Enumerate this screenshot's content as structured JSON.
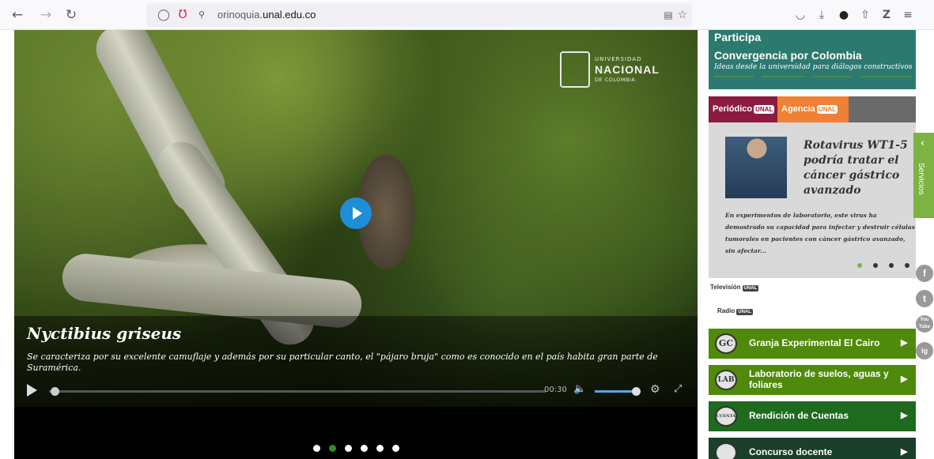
{
  "browser": {
    "back_icon": "back-arrow-icon",
    "forward_icon": "forward-arrow-icon",
    "reload_icon": "reload-icon",
    "url_sub": "orinoquia.",
    "url_main": "unal.edu.co",
    "icons": [
      "shield-icon",
      "permissions-icon",
      "reader-mode-icon",
      "bookmark-star-icon",
      "pocket-icon",
      "download-icon",
      "extension-icon",
      "share-icon",
      "zotero-icon",
      "menu-icon"
    ]
  },
  "hero": {
    "logo": {
      "line1": "UNIVERSIDAD",
      "line2": "NACIONAL",
      "line3": "DE COLOMBIA"
    },
    "title": "Nyctibius griseus",
    "description": "Se caracteriza por su excelente camuflaje y además por su particular canto, el \"pájaro bruja\" como es conocido en el país habita gran parte de Suramérica.",
    "time": "00:30",
    "progress": 0.01,
    "volume": 0.9,
    "slides_total": 6,
    "slides_active": 1
  },
  "sidebar": {
    "participa": {
      "heading": "Participa",
      "title": "Convergencia por Colombia",
      "subtitle": "Ideas desde la universidad para diálogos constructivos"
    },
    "news": {
      "tab1": "Periódico",
      "tab2": "Agencia",
      "badge": "UNAL",
      "title": "Rotavirus WT1-5 podría tratar el cáncer gástrico avanzado",
      "text": "En experimentos de laboratorio, este virus ha demostrado su capacidad para infectar y destruir células tumorales en pacientes con cáncer gástrico avanzado, sin afectar...",
      "dots": 4,
      "active": 0
    },
    "media": {
      "tv": "Televisión",
      "radio": "Radio",
      "badge": "UNAL"
    },
    "links": [
      {
        "icon_text": "GC",
        "label": "Granja Experimental El Cairo",
        "bg": "#4f8a0a"
      },
      {
        "icon_text": "LAB",
        "label": "Laboratorio de suelos, aguas y foliares",
        "bg": "#4f8a0a"
      },
      {
        "icon_text": "CUENTA",
        "label": "Rendición de Cuentas",
        "bg": "#1e6a1e"
      },
      {
        "icon_text": "",
        "label": "Concurso docente",
        "bg": "#1a3f2a"
      }
    ],
    "servicios": "Servicios"
  },
  "social": [
    "f",
    "t",
    "You Tube",
    "ig"
  ],
  "colors": {
    "participa_bg": "#2c7a6f",
    "periodico": "#8c1b3f",
    "agencia": "#f08033",
    "link_green": "#4f8a0a",
    "play_blue": "#1e8ed9",
    "servicios": "#7cb342"
  }
}
